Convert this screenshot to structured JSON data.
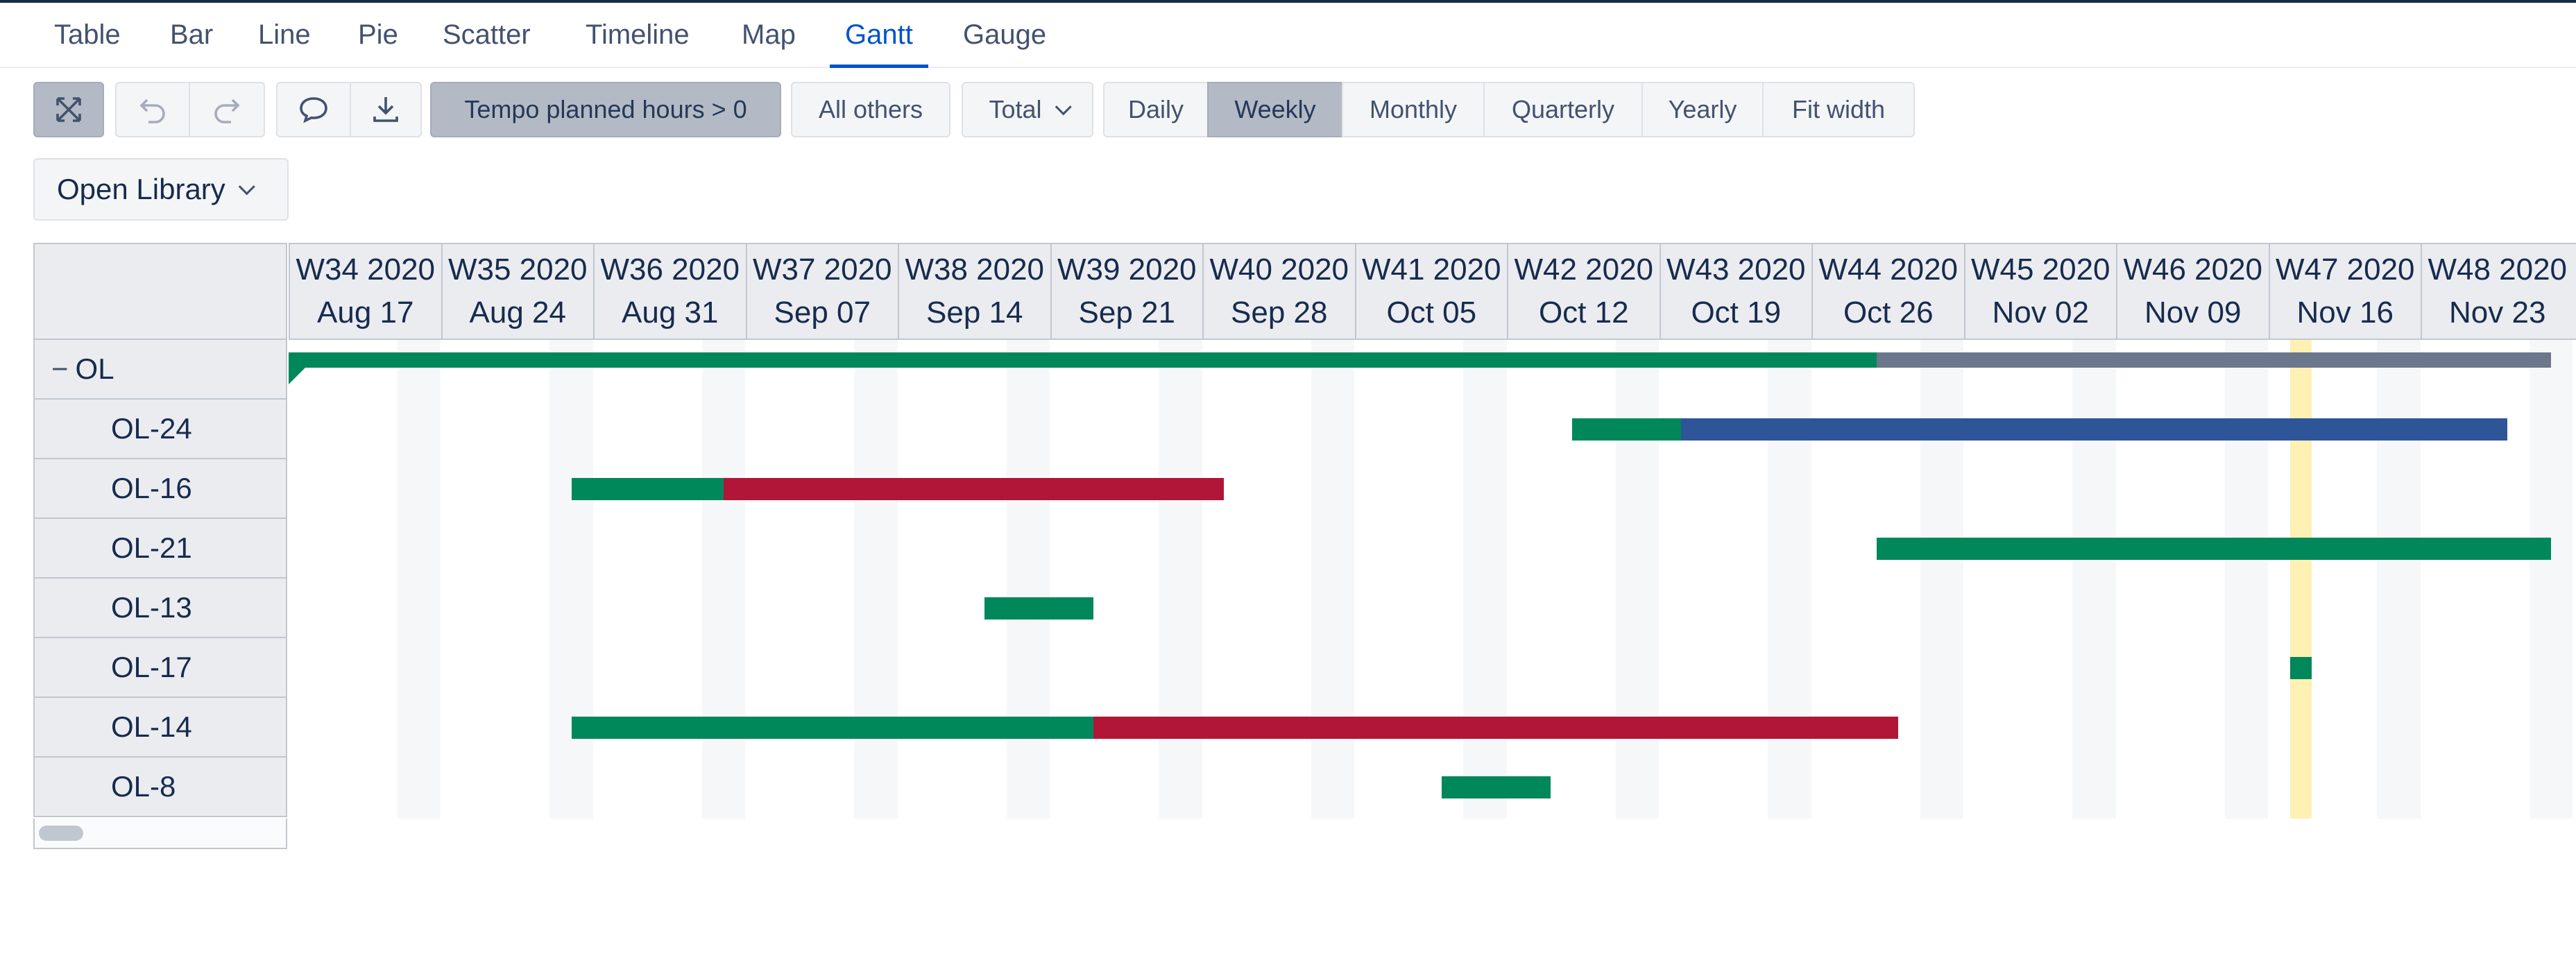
{
  "tabs": [
    {
      "label": "Table",
      "active": false
    },
    {
      "label": "Bar",
      "active": false
    },
    {
      "label": "Line",
      "active": false
    },
    {
      "label": "Pie",
      "active": false
    },
    {
      "label": "Scatter",
      "active": false
    },
    {
      "label": "Timeline",
      "active": false
    },
    {
      "label": "Map",
      "active": false
    },
    {
      "label": "Gantt",
      "active": true
    },
    {
      "label": "Gauge",
      "active": false
    }
  ],
  "toolbar": {
    "icons": [
      "expand-icon",
      "undo-icon",
      "redo-icon",
      "comment-icon",
      "download-icon"
    ],
    "filter_label": "Tempo planned hours > 0",
    "others_label": "All others",
    "total_label": "Total",
    "scale_options": [
      {
        "label": "Daily",
        "selected": false
      },
      {
        "label": "Weekly",
        "selected": true
      },
      {
        "label": "Monthly",
        "selected": false
      },
      {
        "label": "Quarterly",
        "selected": false
      },
      {
        "label": "Yearly",
        "selected": false
      },
      {
        "label": "Fit width",
        "selected": false
      }
    ]
  },
  "library": {
    "label": "Open Library"
  },
  "gantt": {
    "weeks": [
      {
        "week": "W34 2020",
        "date": "Aug 17"
      },
      {
        "week": "W35 2020",
        "date": "Aug 24"
      },
      {
        "week": "W36 2020",
        "date": "Aug 31"
      },
      {
        "week": "W37 2020",
        "date": "Sep 07"
      },
      {
        "week": "W38 2020",
        "date": "Sep 14"
      },
      {
        "week": "W39 2020",
        "date": "Sep 21"
      },
      {
        "week": "W40 2020",
        "date": "Sep 28"
      },
      {
        "week": "W41 2020",
        "date": "Oct 05"
      },
      {
        "week": "W42 2020",
        "date": "Oct 12"
      },
      {
        "week": "W43 2020",
        "date": "Oct 19"
      },
      {
        "week": "W44 2020",
        "date": "Oct 26"
      },
      {
        "week": "W45 2020",
        "date": "Nov 02"
      },
      {
        "week": "W46 2020",
        "date": "Nov 09"
      },
      {
        "week": "W47 2020",
        "date": "Nov 16"
      },
      {
        "week": "W48 2020",
        "date": "Nov 23"
      }
    ],
    "group_toggle": "−",
    "rows": [
      {
        "label": "OL",
        "group": true,
        "segments": [
          {
            "start": "2020-08-17",
            "end": "2020-10-29",
            "status": "done"
          },
          {
            "start": "2020-10-29",
            "end": "2020-11-29",
            "status": "remaining"
          }
        ]
      },
      {
        "label": "OL-24",
        "group": false,
        "segments": [
          {
            "start": "2020-10-15",
            "end": "2020-10-20",
            "status": "done"
          },
          {
            "start": "2020-10-20",
            "end": "2020-11-27",
            "status": "planned"
          }
        ]
      },
      {
        "label": "OL-16",
        "group": false,
        "segments": [
          {
            "start": "2020-08-30",
            "end": "2020-09-06",
            "status": "done"
          },
          {
            "start": "2020-09-06",
            "end": "2020-09-29",
            "status": "overdue"
          }
        ]
      },
      {
        "label": "OL-21",
        "group": false,
        "segments": [
          {
            "start": "2020-10-29",
            "end": "2020-11-29",
            "status": "done"
          }
        ]
      },
      {
        "label": "OL-13",
        "group": false,
        "segments": [
          {
            "start": "2020-09-18",
            "end": "2020-09-23",
            "status": "done"
          }
        ]
      },
      {
        "label": "OL-17",
        "group": false,
        "segments": [
          {
            "start": "2020-11-17",
            "end": "2020-11-18",
            "status": "done"
          }
        ]
      },
      {
        "label": "OL-14",
        "group": false,
        "segments": [
          {
            "start": "2020-08-30",
            "end": "2020-09-23",
            "status": "done"
          },
          {
            "start": "2020-09-23",
            "end": "2020-10-30",
            "status": "overdue"
          }
        ]
      },
      {
        "label": "OL-8",
        "group": false,
        "segments": [
          {
            "start": "2020-10-09",
            "end": "2020-10-14",
            "status": "done"
          }
        ]
      }
    ],
    "today": "2020-11-17",
    "status_colors": {
      "done": "#00875a",
      "remaining": "#6b778c",
      "planned": "#2d5597",
      "overdue": "#b11538"
    }
  }
}
